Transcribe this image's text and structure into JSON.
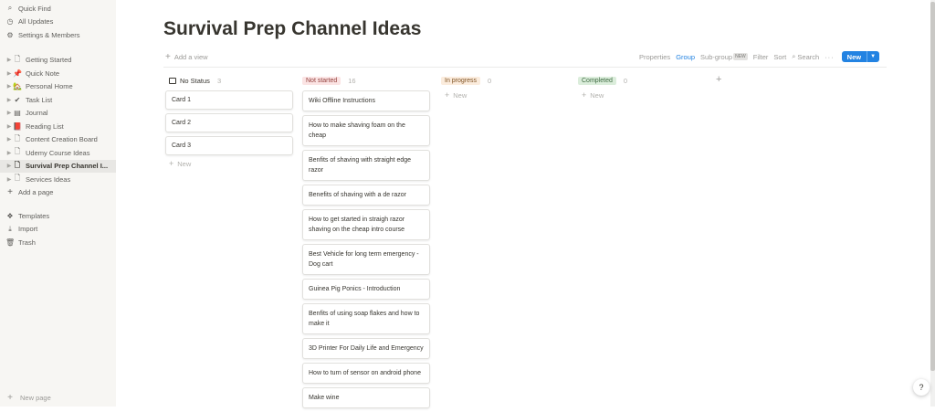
{
  "sidebar": {
    "top": [
      {
        "icon": "search-icon",
        "glyph": "⌕",
        "label": "Quick Find"
      },
      {
        "icon": "clock-icon",
        "glyph": "◷",
        "label": "All Updates"
      },
      {
        "icon": "gear-icon",
        "glyph": "⚙",
        "label": "Settings & Members"
      }
    ],
    "pages": [
      {
        "icon": "page-icon",
        "glyph": "🗋",
        "label": "Getting Started"
      },
      {
        "icon": "pushpin-icon",
        "glyph": "📌",
        "label": "Quick Note"
      },
      {
        "icon": "house-icon",
        "glyph": "🏡",
        "label": "Personal Home"
      },
      {
        "icon": "checkmark-icon",
        "glyph": "✔",
        "label": "Task List"
      },
      {
        "icon": "journal-icon",
        "glyph": "▤",
        "label": "Journal"
      },
      {
        "icon": "book-icon",
        "glyph": "📕",
        "label": "Reading List"
      },
      {
        "icon": "page-icon",
        "glyph": "🗋",
        "label": "Content Creation Board"
      },
      {
        "icon": "page-icon",
        "glyph": "🗋",
        "label": "Udemy Course Ideas"
      },
      {
        "icon": "page-icon",
        "glyph": "🗋",
        "label": "Survival Prep Channel I..."
      },
      {
        "icon": "page-icon",
        "glyph": "🗋",
        "label": "Services Ideas"
      }
    ],
    "add_page": "Add a page",
    "bottom": [
      {
        "icon": "templates-icon",
        "glyph": "❖",
        "label": "Templates"
      },
      {
        "icon": "import-icon",
        "glyph": "⤓",
        "label": "Import"
      },
      {
        "icon": "trash-icon",
        "glyph": "🗑",
        "label": "Trash"
      }
    ],
    "new_page": "New page"
  },
  "page": {
    "title": "Survival Prep Channel Ideas",
    "add_view": "Add a view"
  },
  "toolbar": {
    "properties": "Properties",
    "group": "Group",
    "subgroup": "Sub-group",
    "subgroup_badge": "NEW",
    "filter": "Filter",
    "sort": "Sort",
    "search": "Search",
    "more": "···",
    "new_button": "New"
  },
  "colors": {
    "accent": "#2383e2",
    "not_started_bg": "#fbe4e4",
    "not_started_fg": "#93403d",
    "in_progress_bg": "#fbecdd",
    "in_progress_fg": "#7f5223",
    "completed_bg": "#dbeddb",
    "completed_fg": "#3f6b42"
  },
  "board": {
    "columns": [
      {
        "name": "No Status",
        "count": "3",
        "cards": [
          "Card 1",
          "Card 2",
          "Card 3"
        ],
        "new_label": "New"
      },
      {
        "name": "Not started",
        "count": "16",
        "cards": [
          "Wiki Offline Instructions",
          "How to make shaving foam on the cheap",
          "Benfits of shaving with straight edge razor",
          "Benefits of shaving with a de razor",
          "How to get started in straigh razor shaving on the cheap intro course",
          "Best Vehicle for long term emergency - Dog cart",
          "Guinea Pig Ponics - Introduction",
          "Benfits of using soap flakes and how to make it",
          "3D Printer For Daily Life and Emergency",
          "How to turn of sensor on android phone",
          "Make wine"
        ]
      },
      {
        "name": "In progress",
        "count": "0",
        "cards": [],
        "new_label": "New"
      },
      {
        "name": "Completed",
        "count": "0",
        "cards": [],
        "new_label": "New"
      }
    ],
    "add_group": "+"
  },
  "help": "?"
}
